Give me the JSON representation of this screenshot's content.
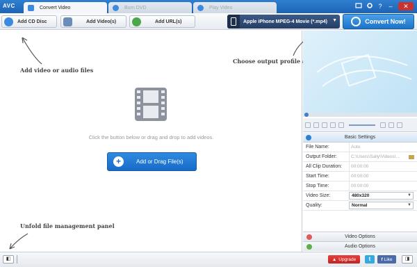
{
  "app": {
    "logo": "AVC"
  },
  "tabs": [
    {
      "label": "Convert Video",
      "active": true,
      "icon": "convert-icon"
    },
    {
      "label": "Burn DVD",
      "active": false,
      "icon": "disc-icon"
    },
    {
      "label": "Play Video",
      "active": false,
      "icon": "play-icon"
    }
  ],
  "window_controls": [
    "share-icon",
    "gear-icon",
    "help-icon",
    "minimize-icon",
    "close-icon"
  ],
  "window_control_glyphs": {
    "help": "?",
    "minimize": "–",
    "close": "✕"
  },
  "toolbar": {
    "add_cd": "Add CD Disc",
    "add_video": "Add Video(s)",
    "add_url": "Add URL(s)",
    "profile": "Apple iPhone MPEG-4 Movie (*.mp4)",
    "convert": "Convert Now!"
  },
  "main": {
    "hint_add": "Add video or audio files",
    "hint_profile": "Choose output profile and convert",
    "hint_unfold": "Unfold file management panel",
    "drop_text": "Click the button below or drag and drop to add videos.",
    "add_drag": "Add or Drag File(s)"
  },
  "settings": {
    "header": "Basic Settings",
    "rows": [
      {
        "label": "File Name:",
        "value": "Auto"
      },
      {
        "label": "Output Folder:",
        "value": "C:\\Users\\Sally\\Videos\\..."
      },
      {
        "label": "All Clip Duration:",
        "value": "00:00:00"
      },
      {
        "label": "Start Time:",
        "value": "00:00:00"
      },
      {
        "label": "Stop Time:",
        "value": "00:00:00"
      },
      {
        "label": "Video Size:",
        "value": "480x320"
      },
      {
        "label": "Quality:",
        "value": "Normal"
      }
    ],
    "video_options": "Video Options",
    "audio_options": "Audio Options"
  },
  "statusbar": {
    "upgrade": "Upgrade",
    "twitter": "t",
    "like": "Like"
  },
  "colors": {
    "accent": "#1d63b5",
    "convert_button": "#1c73c9",
    "upgrade": "#c12523"
  }
}
